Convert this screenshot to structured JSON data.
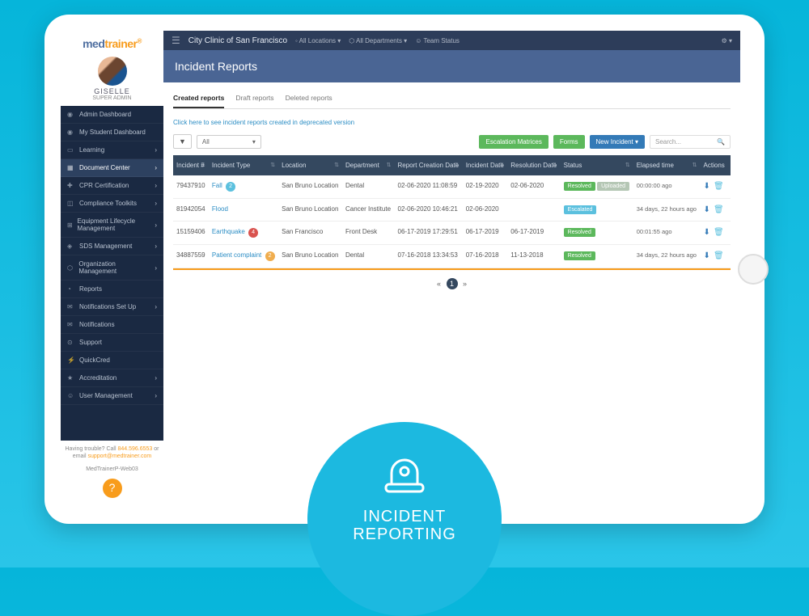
{
  "logo": {
    "part1": "med",
    "part2": "trainer"
  },
  "user": {
    "name": "GISELLE",
    "role": "SUPER ADMIN"
  },
  "sidebar": {
    "items": [
      {
        "label": "Admin Dashboard",
        "icon": "◉",
        "expand": false
      },
      {
        "label": "My Student Dashboard",
        "icon": "◉",
        "expand": false
      },
      {
        "label": "Learning",
        "icon": "▭",
        "expand": true
      },
      {
        "label": "Document Center",
        "icon": "▦",
        "expand": true,
        "active": true
      },
      {
        "label": "CPR Certification",
        "icon": "✚",
        "expand": true
      },
      {
        "label": "Compliance Toolkits",
        "icon": "◫",
        "expand": true
      },
      {
        "label": "Equipment Lifecycle Management",
        "icon": "⊞",
        "expand": true
      },
      {
        "label": "SDS Management",
        "icon": "◈",
        "expand": true
      },
      {
        "label": "Organization Management",
        "icon": "⬡",
        "expand": true
      },
      {
        "label": "Reports",
        "icon": "◔",
        "expand": false
      },
      {
        "label": "Notifications Set Up",
        "icon": "✉",
        "expand": true
      },
      {
        "label": "Notifications",
        "icon": "✉",
        "expand": false
      },
      {
        "label": "Support",
        "icon": "⊙",
        "expand": false
      },
      {
        "label": "QuickCred",
        "icon": "⚡",
        "expand": false
      },
      {
        "label": "Accreditation",
        "icon": "★",
        "expand": true
      },
      {
        "label": "User Management",
        "icon": "☺",
        "expand": true
      }
    ],
    "footer": {
      "trouble": "Having trouble? Call ",
      "phone": "844.596.6553",
      "or_email": " or email ",
      "email": "support@medtrainer.com",
      "server": "MedTrainerP-Web03"
    }
  },
  "topbar": {
    "clinic": "City Clinic of San Francisco",
    "filters": [
      "All Locations ▾",
      "All Departments ▾",
      "Team Status"
    ]
  },
  "page_title": "Incident Reports",
  "tabs": [
    {
      "label": "Created reports",
      "active": true
    },
    {
      "label": "Draft reports",
      "active": false
    },
    {
      "label": "Deleted reports",
      "active": false
    }
  ],
  "deprecated_link": "Click here to see incident reports created in deprecated version",
  "toolbar": {
    "filter_all": "All",
    "btn_escalation": "Escalation Matrices",
    "btn_forms": "Forms",
    "btn_new": "New Incident ▾",
    "search_placeholder": "Search..."
  },
  "table": {
    "headers": [
      "Incident #",
      "Incident Type",
      "Location",
      "Department",
      "Report Creation Date",
      "Incident Date",
      "Resolution Date",
      "Status",
      "Elapsed time",
      "Actions"
    ],
    "rows": [
      {
        "id": "79437910",
        "type": "Fall",
        "badge": "2",
        "badge_color": "blue",
        "location": "San Bruno Location",
        "dept": "Dental",
        "created": "02-06-2020 11:08:59",
        "incident": "02-19-2020",
        "resolution": "02-06-2020",
        "status": [
          "Resolved",
          "Uploaded"
        ],
        "elapsed": "00:00:00 ago"
      },
      {
        "id": "81942054",
        "type": "Flood",
        "badge": "",
        "badge_color": "",
        "location": "San Bruno Location",
        "dept": "Cancer Institute",
        "created": "02-06-2020 10:46:21",
        "incident": "02-06-2020",
        "resolution": "",
        "status": [
          "Escalated"
        ],
        "elapsed": "34 days, 22 hours ago"
      },
      {
        "id": "15159406",
        "type": "Earthquake",
        "badge": "4",
        "badge_color": "red",
        "location": "San Francisco",
        "dept": "Front Desk",
        "created": "06-17-2019 17:29:51",
        "incident": "06-17-2019",
        "resolution": "06-17-2019",
        "status": [
          "Resolved"
        ],
        "elapsed": "00:01:55 ago"
      },
      {
        "id": "34887559",
        "type": "Patient complaint",
        "badge": "2",
        "badge_color": "yellow",
        "location": "San Bruno Location",
        "dept": "Dental",
        "created": "07-16-2018 13:34:53",
        "incident": "07-16-2018",
        "resolution": "11-13-2018",
        "status": [
          "Resolved"
        ],
        "elapsed": "34 days, 22 hours ago"
      }
    ],
    "page": "1"
  },
  "promo": {
    "title_line1": "INCIDENT",
    "title_line2": "REPORTING"
  }
}
